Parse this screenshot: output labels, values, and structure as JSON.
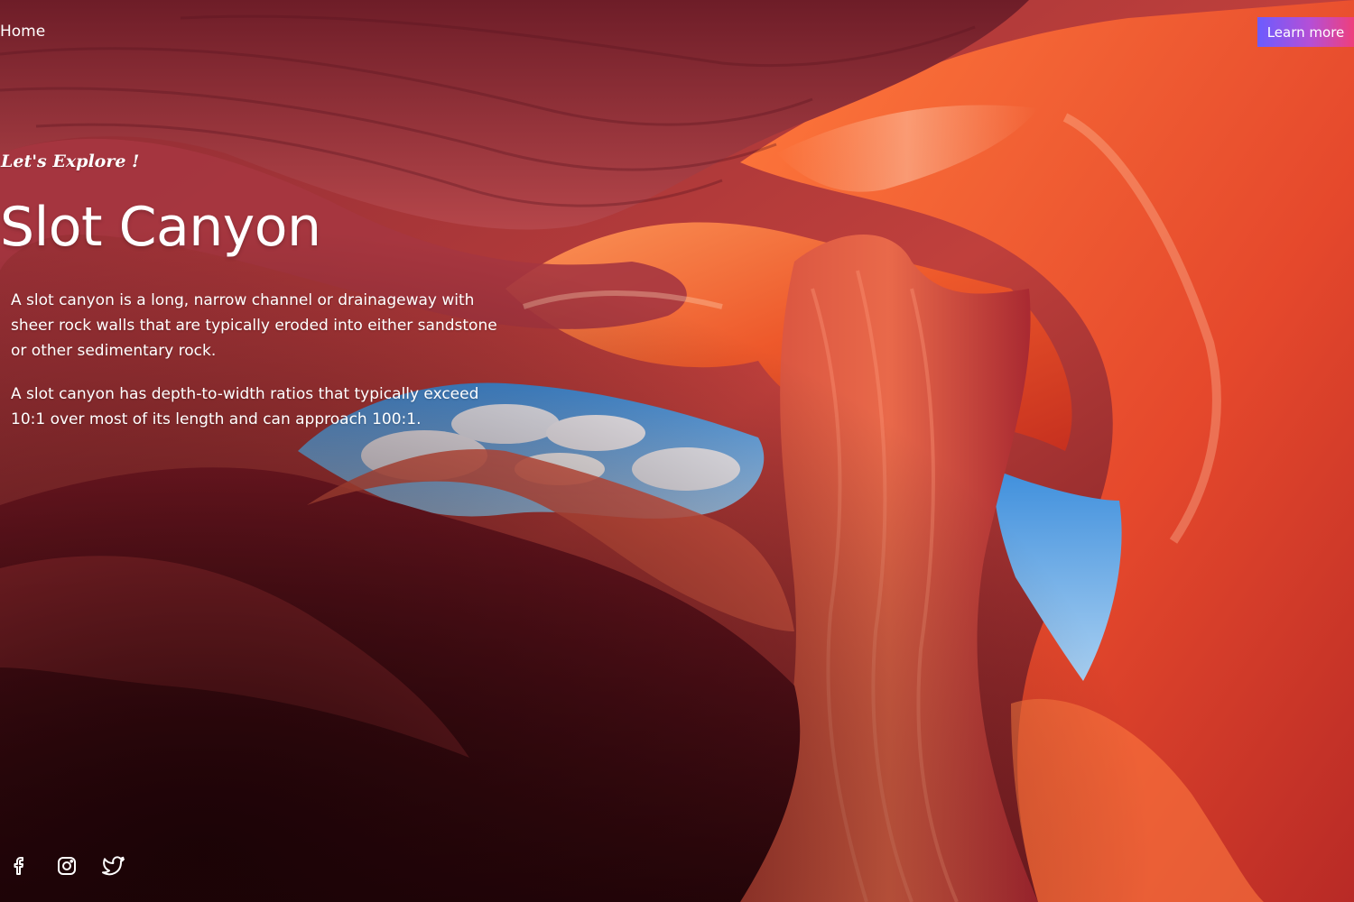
{
  "nav": {
    "home_label": "Home",
    "learn_more_label": "Learn more"
  },
  "hero": {
    "tagline": "Let's Explore !",
    "title": "Slot Canyon",
    "paragraphs": [
      "A slot canyon is a long, narrow channel or drainageway with sheer rock walls that are typically eroded into either sandstone or other sedimentary rock.",
      "A slot canyon has depth-to-width ratios that typically exceed 10:1 over most of its length and can approach 100:1."
    ]
  },
  "socials": [
    {
      "icon": "facebook-icon"
    },
    {
      "icon": "instagram-icon"
    },
    {
      "icon": "twitter-icon"
    }
  ],
  "colors": {
    "button_gradient_start": "#6b5cff",
    "button_gradient_end": "#ef3f7c",
    "rock_dark": "#3a0a10",
    "rock_red": "#c83a3e",
    "rock_orange": "#f06a2c",
    "sky_blue": "#5ea8e8"
  }
}
